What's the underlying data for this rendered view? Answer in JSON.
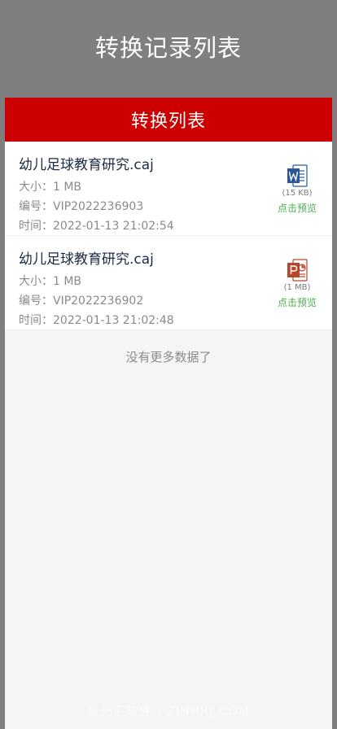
{
  "header": {
    "title": "转换记录列表"
  },
  "panel": {
    "title": "转换列表"
  },
  "records": [
    {
      "name": "幼儿足球教育研究.caj",
      "size_label": "大小：",
      "size_value": "1 MB",
      "id_label": "编号：",
      "id_value": "VIP2022236903",
      "time_label": "时间：",
      "time_value": "2022-01-13 21:02:54",
      "icon": "word-file-icon",
      "file_size": "(15 KB)",
      "preview": "点击预览"
    },
    {
      "name": "幼儿足球教育研究.caj",
      "size_label": "大小：",
      "size_value": "1 MB",
      "id_label": "编号：",
      "id_value": "VIP2022236902",
      "time_label": "时间：",
      "time_value": "2022-01-13 21:02:48",
      "icon": "powerpoint-file-icon",
      "file_size": "(1 MB)",
      "preview": "点击预览"
    }
  ],
  "footer": {
    "no_more": "没有更多数据了"
  },
  "watermark": "极光汇软件 · ZIHHRJ.COM",
  "colors": {
    "accent": "#cc0000",
    "preview": "#4caf50",
    "backdrop": "#7f7f7f"
  }
}
